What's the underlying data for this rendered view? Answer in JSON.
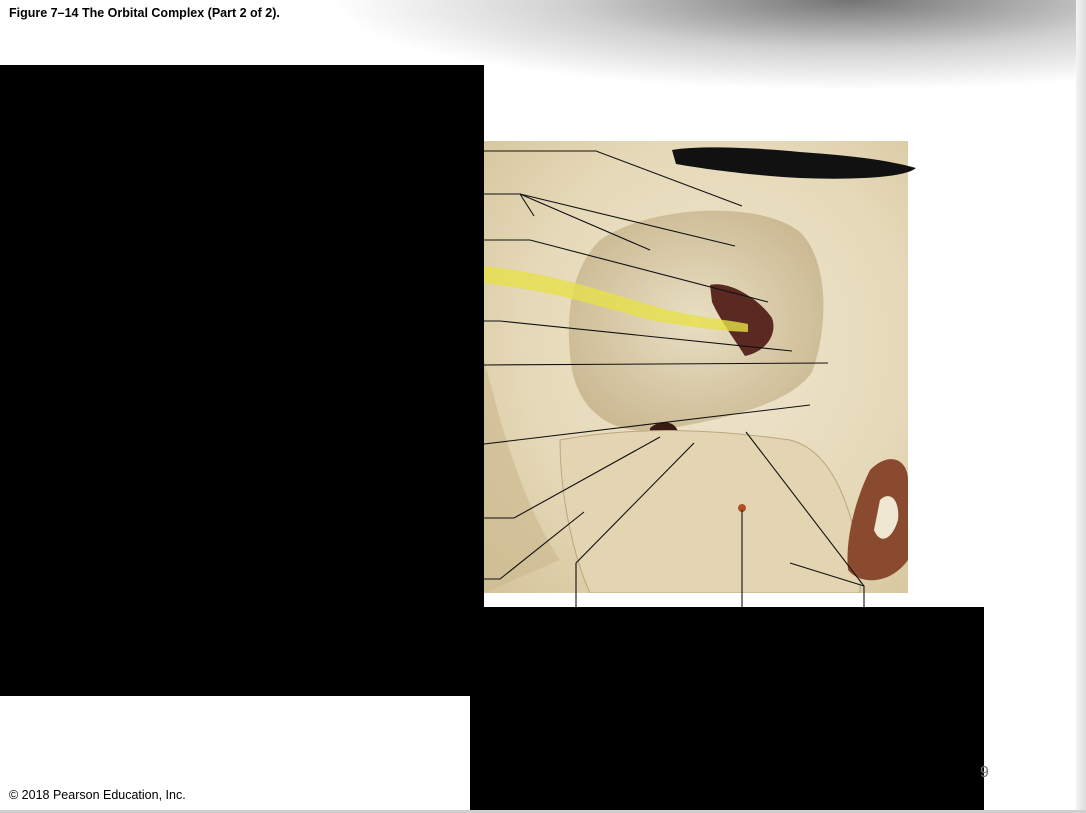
{
  "figure": {
    "title": "Figure 7–14 The Orbital Complex (Part 2 of 2).",
    "copyright": "© 2018 Pearson Education, Inc.",
    "page_number": "9"
  },
  "photo": {
    "subject": "photograph of skull orbit (bone)",
    "bone_color": "#e8dcc0",
    "highlight_color": "#e6e04a"
  }
}
